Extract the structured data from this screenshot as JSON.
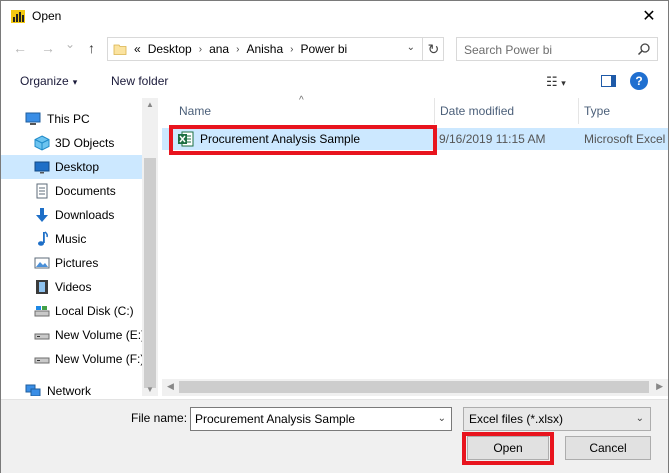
{
  "window": {
    "title": "Open",
    "app_icon": "power-bi-icon",
    "close_glyph": "✕"
  },
  "navigation": {
    "back_glyph": "←",
    "forward_glyph": "→",
    "recent_glyph": "⌄",
    "up_glyph": "↑",
    "breadcrumb": [
      "«",
      "Desktop",
      "ana",
      "Anisha",
      "Power bi"
    ],
    "separator_glyph": "›",
    "dropdown_glyph": "⌄",
    "refresh_glyph": "↻",
    "search_placeholder": "Search Power bi"
  },
  "toolbar": {
    "organize": "Organize",
    "caret": "▾",
    "new_folder": "New folder",
    "view_glyph": "☷",
    "view_caret": "▾",
    "help_glyph": "?"
  },
  "sidebar": {
    "items": [
      {
        "label": "This PC",
        "icon": "computer-icon"
      },
      {
        "label": "3D Objects",
        "icon": "cube-icon"
      },
      {
        "label": "Desktop",
        "icon": "desktop-icon",
        "selected": true
      },
      {
        "label": "Documents",
        "icon": "document-icon"
      },
      {
        "label": "Downloads",
        "icon": "download-icon"
      },
      {
        "label": "Music",
        "icon": "music-icon"
      },
      {
        "label": "Pictures",
        "icon": "picture-icon"
      },
      {
        "label": "Videos",
        "icon": "video-icon"
      },
      {
        "label": "Local Disk (C:)",
        "icon": "disk-icon"
      },
      {
        "label": "New Volume (E:)",
        "icon": "drive-icon"
      },
      {
        "label": "New Volume (F:)",
        "icon": "drive-icon"
      },
      {
        "label": "Network",
        "icon": "network-icon"
      }
    ]
  },
  "file_list": {
    "columns": [
      "Name",
      "Date modified",
      "Type"
    ],
    "sort_caret": "^",
    "rows": [
      {
        "name": "Procurement Analysis Sample",
        "date": "9/16/2019 11:15 AM",
        "type": "Microsoft Excel",
        "icon": "excel-icon",
        "selected": true
      }
    ]
  },
  "footer": {
    "file_name_label": "File name:",
    "file_name_value": "Procurement Analysis Sample",
    "file_type": "Excel files (*.xlsx)",
    "open_button": "Open",
    "cancel_button": "Cancel"
  },
  "colors": {
    "selection": "#cce8ff",
    "highlight": "#e8141e",
    "help": "#1f6fd0"
  }
}
